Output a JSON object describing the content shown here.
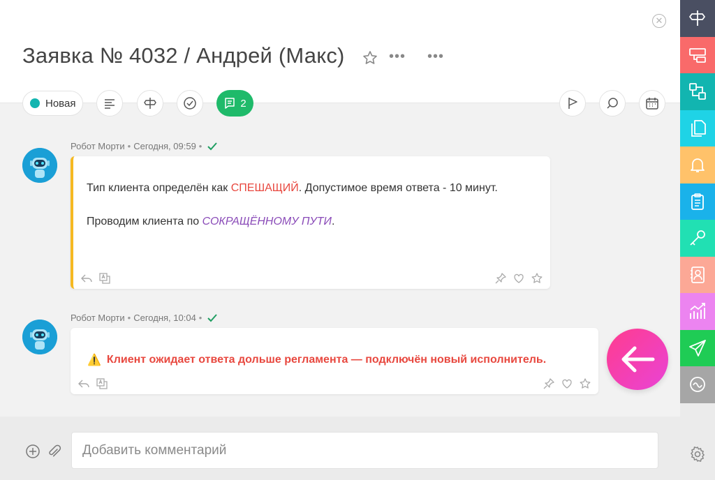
{
  "header": {
    "close_label": "✕",
    "title": "Заявка № 4032 / Андрей (Макс)",
    "menu_dots": "•••"
  },
  "toolbar": {
    "status_label": "Новая",
    "status_color": "#12b5b0",
    "comments_count": "2",
    "comments_color": "#1fba6a"
  },
  "messages": [
    {
      "author": "Робот Морти",
      "dot": "•",
      "time": "Сегодня, 09:59",
      "line1_prefix": "Тип клиента определён как ",
      "line1_highlight": "СПЕШАЩИЙ",
      "line1_suffix": ". Допустимое время ответа - 10 минут.",
      "line2_prefix": "Проводим клиента по ",
      "line2_highlight": "СОКРАЩЁННОМУ ПУТИ",
      "line2_suffix": ".",
      "border_color": "#f5b921"
    },
    {
      "author": "Робот Морти",
      "dot": "•",
      "time": "Сегодня, 10:04",
      "warning_icon": "⚠️",
      "warning_text": "Клиент ожидает ответа дольше регламента — подключён новый исполнитель."
    }
  ],
  "footer": {
    "comment_placeholder": "Добавить комментарий"
  },
  "sidebar": {
    "items": [
      {
        "icon": "signpost-icon",
        "color": "#4a4f62"
      },
      {
        "icon": "layers-icon",
        "color": "#f96a6a"
      },
      {
        "icon": "structure-icon",
        "color": "#12b5b0"
      },
      {
        "icon": "documents-icon",
        "color": "#1fd3e6"
      },
      {
        "icon": "bell-icon",
        "color": "#ffc26a"
      },
      {
        "icon": "clipboard-icon",
        "color": "#1ab2ea"
      },
      {
        "icon": "key-icon",
        "color": "#21e0b3"
      },
      {
        "icon": "contact-icon",
        "color": "#fca896"
      },
      {
        "icon": "chart-icon",
        "color": "#ec84f0"
      },
      {
        "icon": "send-icon",
        "color": "#1fcc55"
      },
      {
        "icon": "wave-icon",
        "color": "#a6a6a6"
      }
    ]
  }
}
